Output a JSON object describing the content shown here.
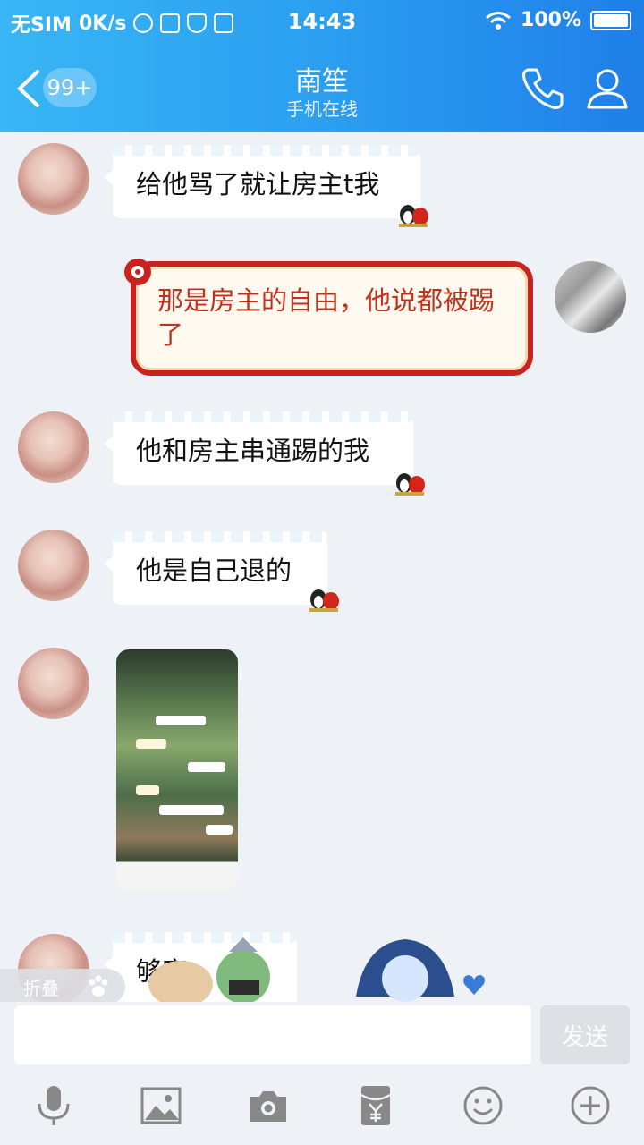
{
  "status_bar": {
    "carrier": "无SIM",
    "speed": "0K/s",
    "time": "14:43",
    "battery": "100%"
  },
  "header": {
    "unread_badge": "99+",
    "contact_name": "南笙",
    "contact_status": "手机在线"
  },
  "messages": [
    {
      "sender": "other",
      "text": "给他骂了就让房主t我"
    },
    {
      "sender": "self",
      "text": "那是房主的自由，他说都被踢了"
    },
    {
      "sender": "other",
      "text": "他和房主串通踢的我"
    },
    {
      "sender": "other",
      "text": "他是自己退的"
    },
    {
      "sender": "other",
      "type": "image"
    },
    {
      "sender": "other",
      "text": "够容"
    }
  ],
  "floating_tag": "折叠",
  "input_bar": {
    "placeholder": "",
    "send_label": "发送"
  },
  "toolbar_icons": [
    "microphone-icon",
    "image-icon",
    "camera-icon",
    "red-packet-icon",
    "emoji-icon",
    "plus-icon"
  ],
  "colors": {
    "header_start": "#38b6f5",
    "header_end": "#1f7fe8",
    "chat_bg": "#eef1f6",
    "self_bubble_border": "#c8231e",
    "self_bubble_text": "#c0301b"
  }
}
